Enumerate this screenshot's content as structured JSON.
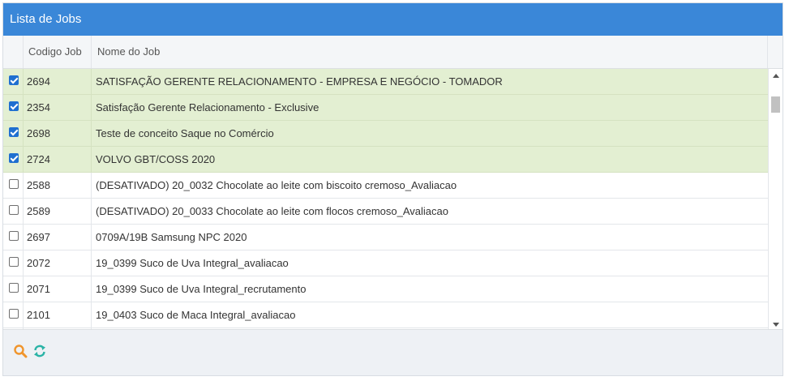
{
  "panel": {
    "title": "Lista de Jobs"
  },
  "columns": {
    "code": "Codigo Job",
    "name": "Nome do Job"
  },
  "rows": [
    {
      "code": "2694",
      "name": "SATISFAÇÃO GERENTE RELACIONAMENTO - EMPRESA E NEGÓCIO - TOMADOR",
      "checked": true
    },
    {
      "code": "2354",
      "name": "Satisfação Gerente Relacionamento - Exclusive",
      "checked": true
    },
    {
      "code": "2698",
      "name": "Teste de conceito Saque no Comércio",
      "checked": true
    },
    {
      "code": "2724",
      "name": "VOLVO GBT/COSS 2020",
      "checked": true
    },
    {
      "code": "2588",
      "name": "(DESATIVADO) 20_0032 Chocolate ao leite com biscoito cremoso_Avaliacao",
      "checked": false
    },
    {
      "code": "2589",
      "name": "(DESATIVADO) 20_0033 Chocolate ao leite com flocos cremoso_Avaliacao",
      "checked": false
    },
    {
      "code": "2697",
      "name": "0709A/19B Samsung NPC 2020",
      "checked": false
    },
    {
      "code": "2072",
      "name": "19_0399 Suco de Uva Integral_avaliacao",
      "checked": false
    },
    {
      "code": "2071",
      "name": "19_0399 Suco de Uva Integral_recrutamento",
      "checked": false
    },
    {
      "code": "2101",
      "name": "19_0403 Suco de Maca Integral_avaliacao",
      "checked": false
    },
    {
      "code": "",
      "name": "",
      "checked": false
    }
  ],
  "toolbar": {
    "search_icon": "search-icon",
    "refresh_icon": "refresh-icon"
  },
  "colors": {
    "header": "#3a87d8",
    "selected_row": "#e3efd2",
    "search_icon": "#f0952c",
    "refresh_icon": "#2ab3a6"
  }
}
